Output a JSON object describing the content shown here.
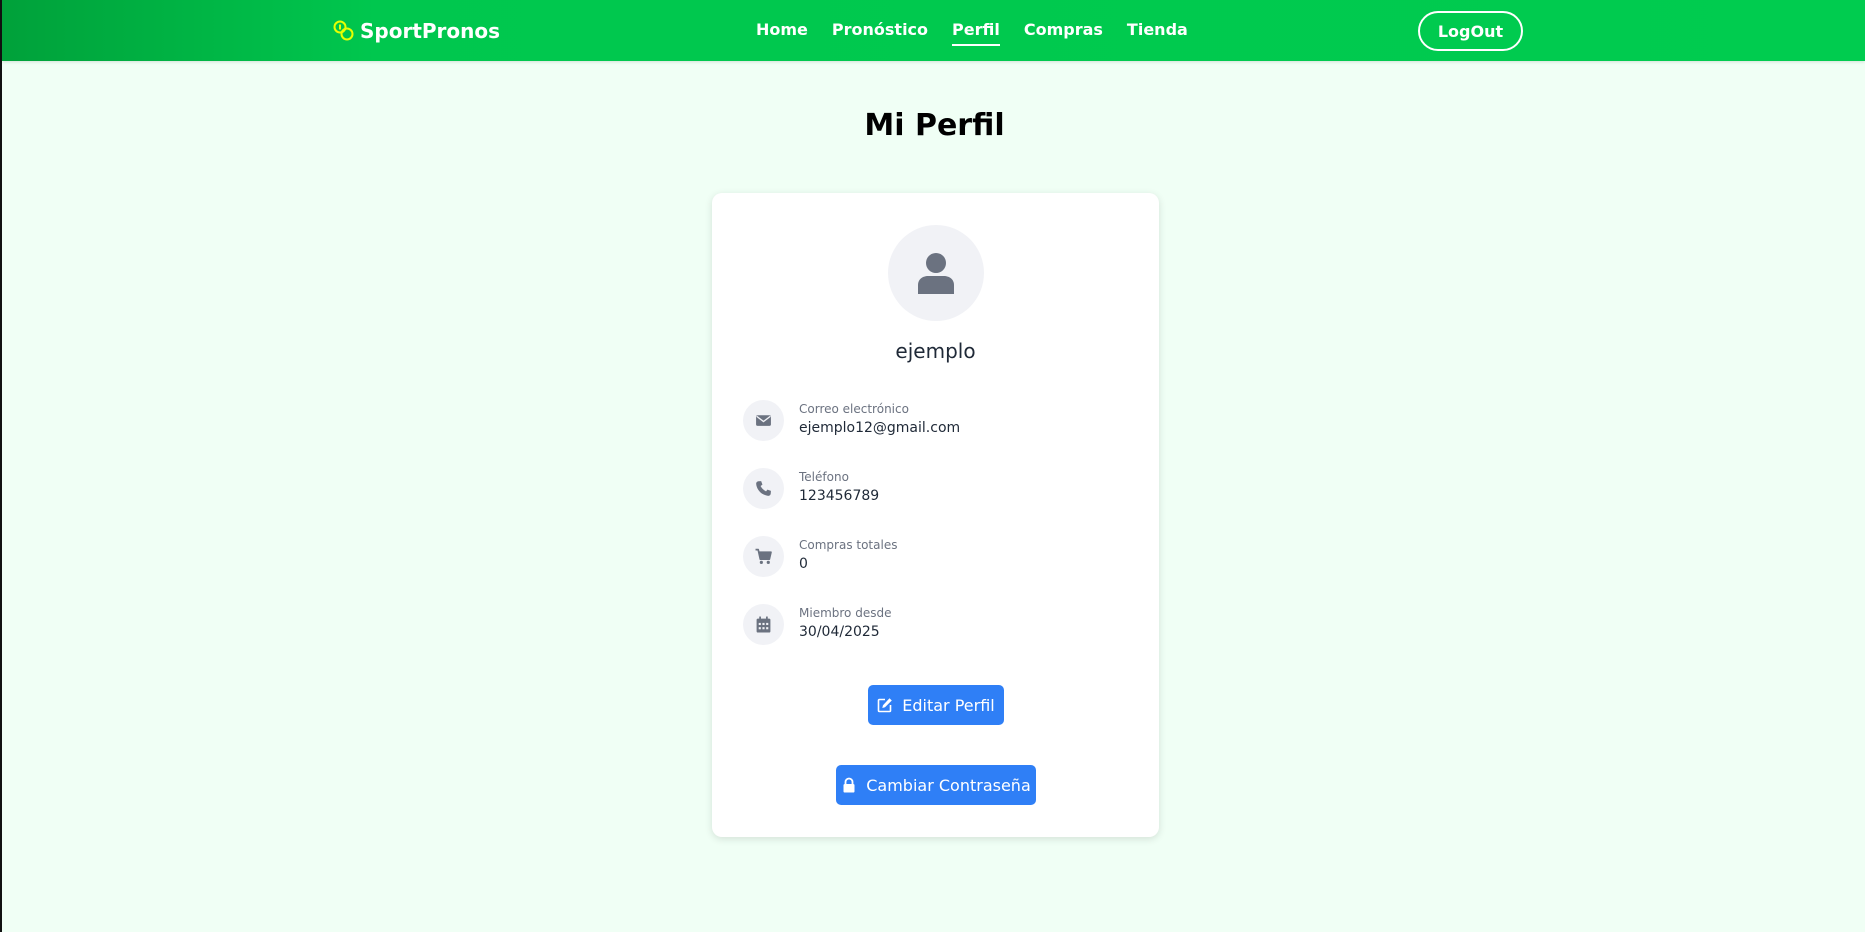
{
  "brand": {
    "name": "SportPronos",
    "logo_icon": "coins-icon"
  },
  "nav": {
    "items": [
      {
        "label": "Home",
        "active": false
      },
      {
        "label": "Pronóstico",
        "active": false
      },
      {
        "label": "Perfil",
        "active": true
      },
      {
        "label": "Compras",
        "active": false
      },
      {
        "label": "Tienda",
        "active": false
      }
    ],
    "logout_label": "LogOut"
  },
  "page": {
    "title": "Mi Perfil"
  },
  "profile": {
    "avatar_icon": "user-icon",
    "username": "ejemplo",
    "fields": [
      {
        "icon": "envelope-icon",
        "label": "Correo electrónico",
        "value": "ejemplo12@gmail.com"
      },
      {
        "icon": "phone-icon",
        "label": "Teléfono",
        "value": "123456789"
      },
      {
        "icon": "cart-icon",
        "label": "Compras totales",
        "value": "0"
      },
      {
        "icon": "calendar-icon",
        "label": "Miembro desde",
        "value": "30/04/2025"
      }
    ]
  },
  "actions": {
    "edit_label": "Editar Perfil",
    "change_password_label": "Cambiar Contraseña"
  },
  "colors": {
    "nav_green": "#00cc4f",
    "background": "#f0fff5",
    "button_blue": "#2f7ff6",
    "icon_gray": "#6b7280"
  }
}
